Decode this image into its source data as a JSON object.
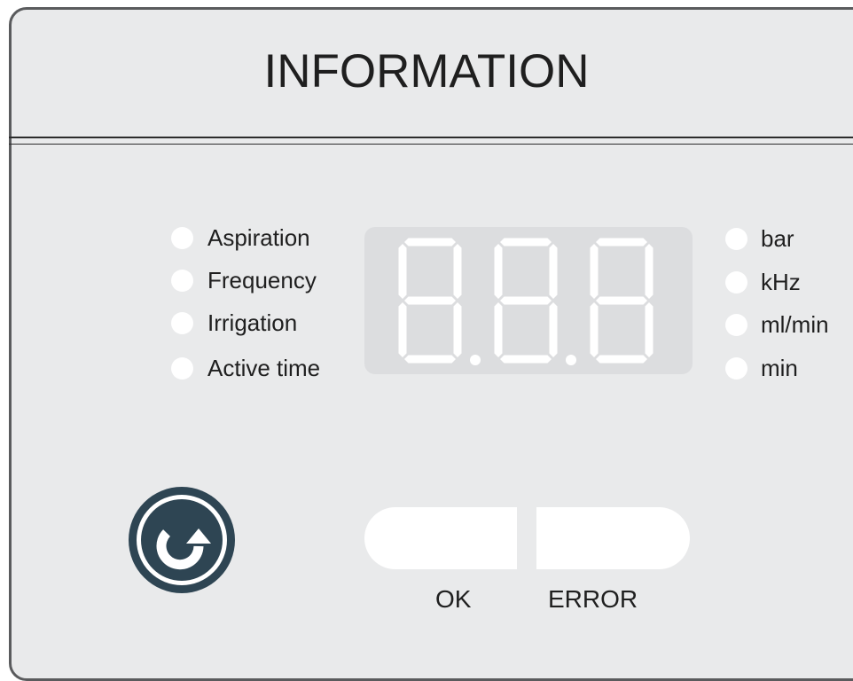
{
  "panel": {
    "title": "INFORMATION"
  },
  "indicators": {
    "parameters": [
      {
        "label": "Aspiration"
      },
      {
        "label": "Frequency"
      },
      {
        "label": "Irrigation"
      },
      {
        "label": "Active time"
      }
    ],
    "units": [
      {
        "label": "bar"
      },
      {
        "label": "kHz"
      },
      {
        "label": "ml/min"
      },
      {
        "label": "min"
      }
    ]
  },
  "display": {
    "digits": 3,
    "decimal_points": 2,
    "state": "off"
  },
  "controls": {
    "reset_icon": "refresh-icon"
  },
  "status": {
    "ok_label": "OK",
    "error_label": "ERROR"
  },
  "colors": {
    "panel_bg": "#e9eaeb",
    "border": "#5a5b5d",
    "led_off": "#ffffff",
    "display_bg": "#dcdddf",
    "reset_button": "#2e4553"
  }
}
